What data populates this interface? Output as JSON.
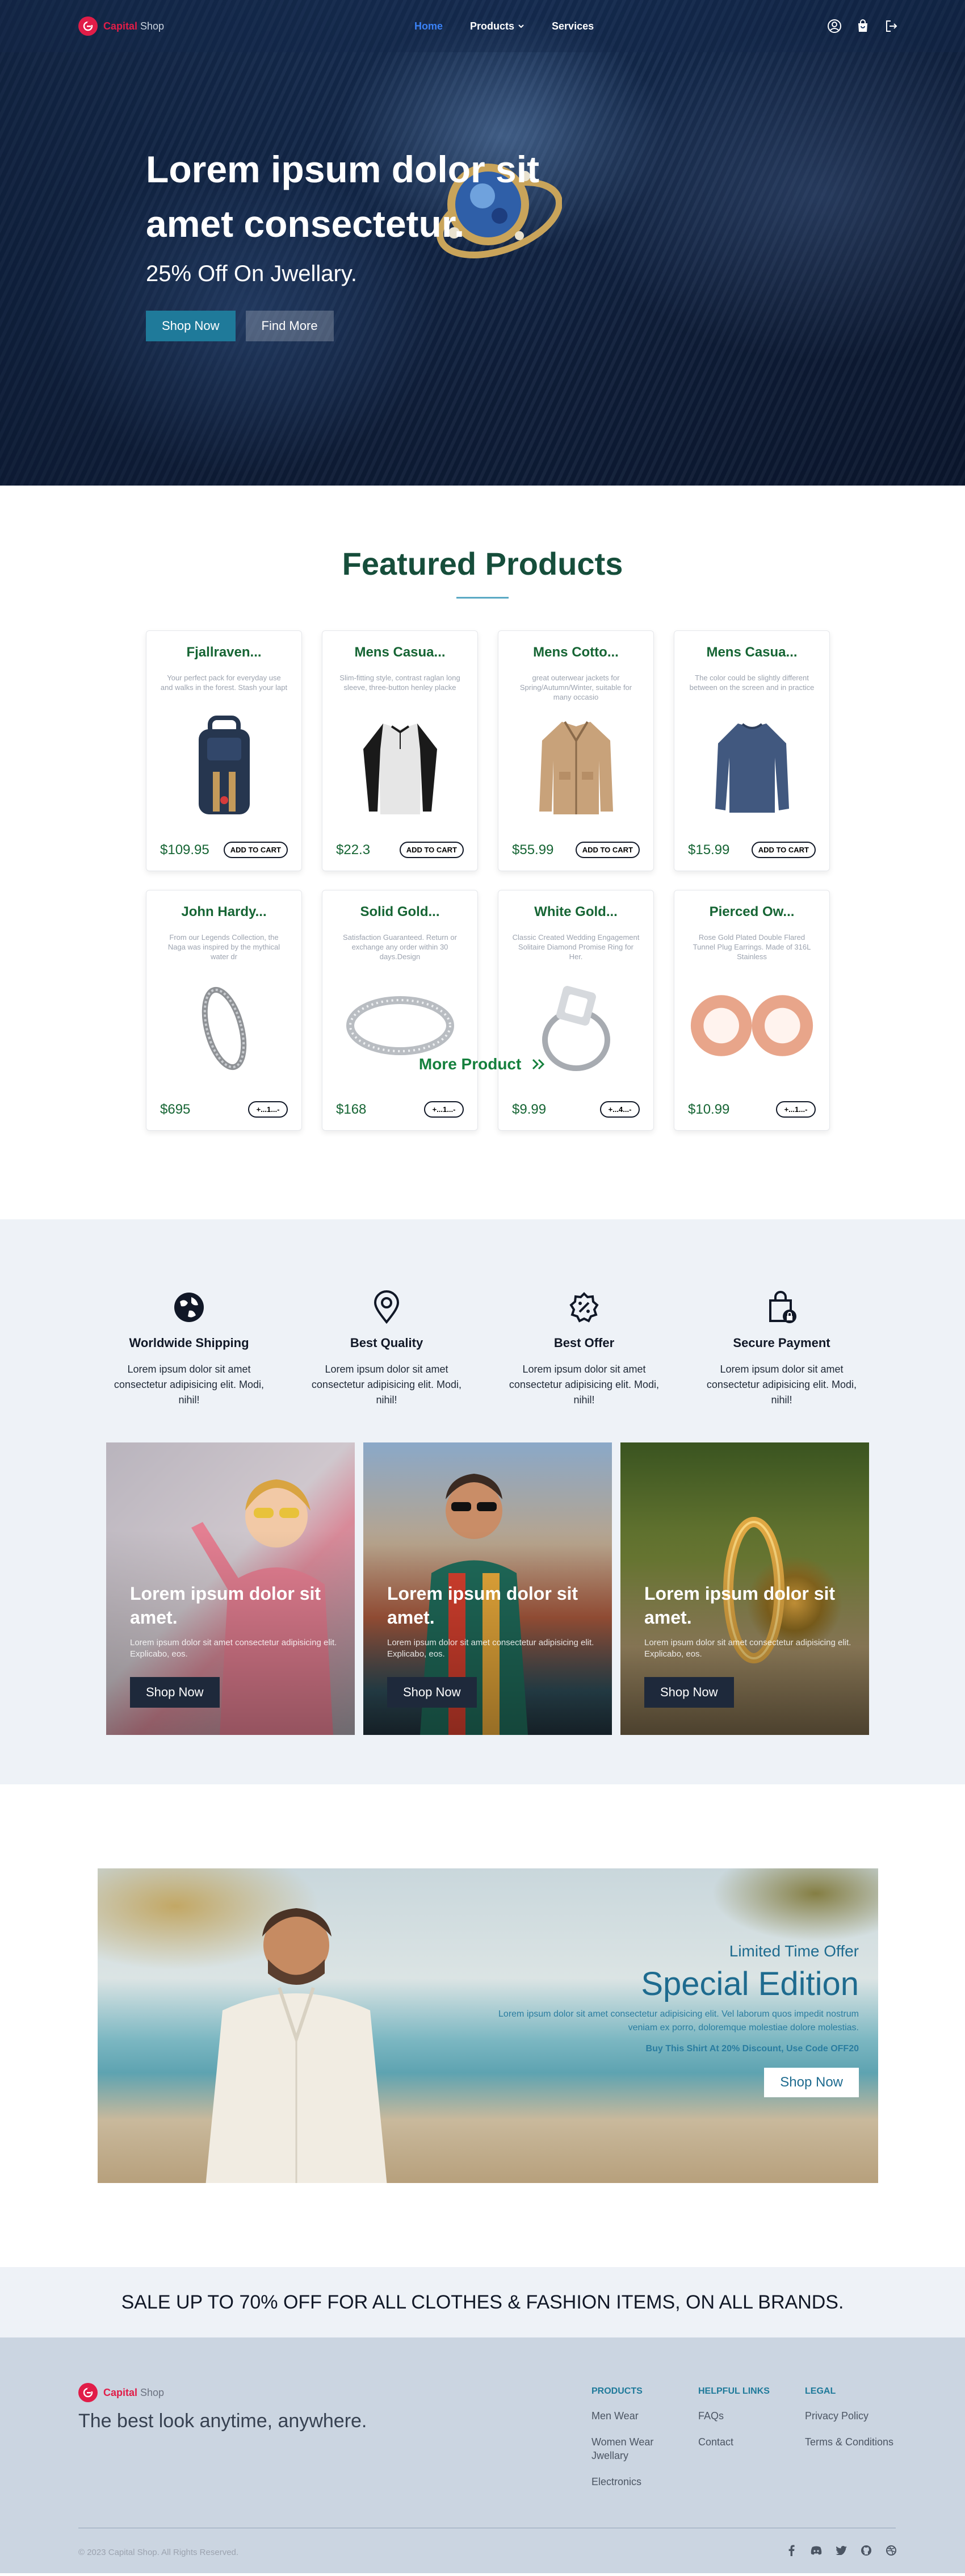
{
  "nav": {
    "brand_name": "Capital",
    "brand_suffix": "Shop",
    "links": [
      "Home",
      "Products",
      "Services"
    ]
  },
  "hero": {
    "title": "Lorem ipsum dolor sit amet consectetur.",
    "subtitle": "25% Off On Jwellary.",
    "primary_button": "Shop Now",
    "secondary_button": "Find More"
  },
  "featured": {
    "title": "Featured Products",
    "products": [
      {
        "name": "Fjallraven...",
        "desc": "Your perfect pack for everyday use and walks in the forest. Stash your lapt",
        "price": "$109.95",
        "button": "ADD TO CART",
        "img": "backpack-icon"
      },
      {
        "name": "Mens Casua...",
        "desc": "Slim-fitting style, contrast raglan long sleeve, three-button henley placke",
        "price": "$22.3",
        "button": "ADD TO CART",
        "img": "raglan-shirt-icon"
      },
      {
        "name": "Mens Cotto...",
        "desc": "great outerwear jackets for Spring/Autumn/Winter, suitable for many occasio",
        "price": "$55.99",
        "button": "ADD TO CART",
        "img": "jacket-icon"
      },
      {
        "name": "Mens Casua...",
        "desc": "The color could be slightly different between on the screen and in practice",
        "price": "$15.99",
        "button": "ADD TO CART",
        "img": "longsleeve-icon"
      },
      {
        "name": "John Hardy...",
        "desc": "From our Legends Collection, the Naga was inspired by the mythical water dr",
        "price": "$695",
        "button": "+...1...-",
        "img": "bracelet-icon"
      },
      {
        "name": "Solid Gold...",
        "desc": "Satisfaction Guaranteed. Return or exchange any order within 30 days.Design",
        "price": "$168",
        "button": "+...1...-",
        "img": "ring-icon"
      },
      {
        "name": "White Gold...",
        "desc": "Classic Created Wedding Engagement Solitaire Diamond Promise Ring for Her.",
        "price": "$9.99",
        "button": "+...4...-",
        "img": "diamond-ring-icon"
      },
      {
        "name": "Pierced Ow...",
        "desc": "Rose Gold Plated Double Flared Tunnel Plug Earrings. Made of 316L Stainless",
        "price": "$10.99",
        "button": "+...1...-",
        "img": "plug-earrings-icon"
      }
    ],
    "more_label": "More Product"
  },
  "features": [
    {
      "title": "Worldwide Shipping",
      "text": "Lorem ipsum dolor sit amet consectetur adipisicing elit. Modi, nihil!",
      "icon": "globe-icon"
    },
    {
      "title": "Best Quality",
      "text": "Lorem ipsum dolor sit amet consectetur adipisicing elit. Modi, nihil!",
      "icon": "map-pin-icon"
    },
    {
      "title": "Best Offer",
      "text": "Lorem ipsum dolor sit amet consectetur adipisicing elit. Modi, nihil!",
      "icon": "discount-badge-icon"
    },
    {
      "title": "Secure Payment",
      "text": "Lorem ipsum dolor sit amet consectetur adipisicing elit. Modi, nihil!",
      "icon": "secure-bag-icon"
    }
  ],
  "promos": [
    {
      "title": "Lorem ipsum dolor sit amet.",
      "text": "Lorem ipsum dolor sit amet consectetur adipisicing elit. Explicabo, eos.",
      "button": "Shop Now"
    },
    {
      "title": "Lorem ipsum dolor sit amet.",
      "text": "Lorem ipsum dolor sit amet consectetur adipisicing elit. Explicabo, eos.",
      "button": "Shop Now"
    },
    {
      "title": "Lorem ipsum dolor sit amet.",
      "text": "Lorem ipsum dolor sit amet consectetur adipisicing elit. Explicabo, eos.",
      "button": "Shop Now"
    }
  ],
  "special": {
    "eyebrow": "Limited Time Offer",
    "title": "Special Edition",
    "text": "Lorem ipsum dolor sit amet consectetur adipisicing elit. Vel laborum quos impedit nostrum veniam ex porro, doloremque molestiae dolore molestias.",
    "code": "Buy This Shirt At 20% Discount, Use Code OFF20",
    "button": "Shop Now"
  },
  "sale_strip": "SALE UP TO 70% OFF FOR ALL CLOTHES & FASHION ITEMS, ON ALL BRANDS.",
  "footer": {
    "brand_name": "Capital",
    "brand_suffix": "Shop",
    "tagline": "The best look anytime, anywhere.",
    "columns": [
      {
        "title": "PRODUCTS",
        "links": [
          "Men Wear",
          "Women Wear Jwellary",
          "Electronics"
        ]
      },
      {
        "title": "HELPFUL LINKS",
        "links": [
          "FAQs",
          "Contact"
        ]
      },
      {
        "title": "LEGAL",
        "links": [
          "Privacy Policy",
          "Terms & Conditions"
        ]
      }
    ],
    "copyright": "© 2023 Capital Shop. All Rights Reserved.",
    "social": [
      "facebook-icon",
      "discord-icon",
      "twitter-icon",
      "github-icon",
      "dribbble-icon"
    ]
  },
  "colors": {
    "brand": "#e11d48",
    "accent": "#1f7a9a",
    "product_green": "#166534",
    "footer_bg": "#cbd5e1",
    "section_bg": "#eef2f7"
  }
}
